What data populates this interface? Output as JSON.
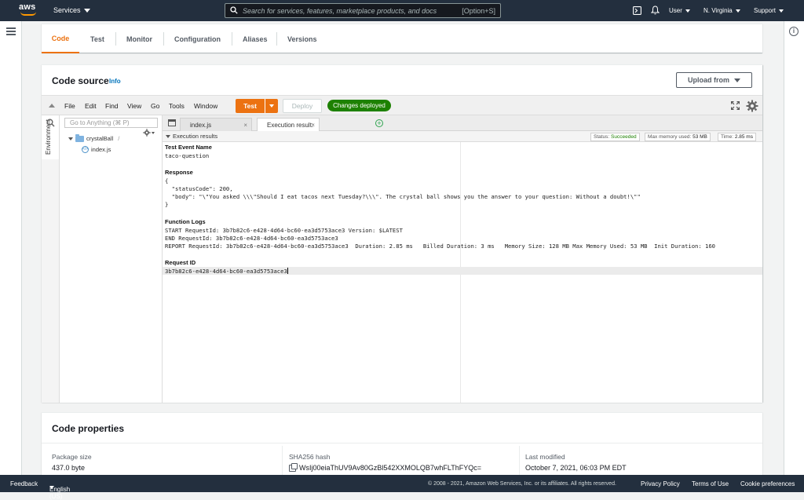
{
  "topnav": {
    "logo": "aws",
    "services_label": "Services",
    "search_placeholder": "Search for services, features, marketplace products, and docs",
    "search_shortcut": "[Option+S]",
    "user_label": "User",
    "region_label": "N. Virginia",
    "support_label": "Support",
    "icons": [
      "terminal-icon",
      "bell-icon"
    ]
  },
  "tabs": [
    {
      "label": "Code",
      "active": true
    },
    {
      "label": "Test"
    },
    {
      "label": "Monitor"
    },
    {
      "label": "Configuration"
    },
    {
      "label": "Aliases"
    },
    {
      "label": "Versions"
    }
  ],
  "code_source": {
    "title": "Code source",
    "info": "Info",
    "upload_label": "Upload from"
  },
  "ide": {
    "menus": [
      "File",
      "Edit",
      "Find",
      "View",
      "Go",
      "Tools",
      "Window"
    ],
    "test_label": "Test",
    "deploy_label": "Deploy",
    "deployed_badge": "Changes deployed",
    "environment_label": "Environment",
    "goto_placeholder": "Go to Anything (⌘ P)",
    "tree": {
      "folder": "crystalBall",
      "folder_suffix": "/",
      "file": "index.js"
    },
    "editor_tabs": [
      {
        "label": "index.js",
        "active": false
      },
      {
        "label": "Execution result:",
        "active": true
      }
    ],
    "results_title": "Execution results",
    "status_label": "Status:",
    "status_value": "Succeeded",
    "memory_label": "Max memory used:",
    "memory_value": "53 MB",
    "time_label": "Time:",
    "time_value": "2.85 ms",
    "results": {
      "test_event_label": "Test Event Name",
      "test_event_value": "taco-question",
      "response_label": "Response",
      "response_lines": [
        "{",
        "  \"statusCode\": 200,",
        "  \"body\": \"\\\"You asked \\\\\\\"Should I eat tacos next Tuesday?\\\\\\\". The crystal ball shows you the answer to your question: Without a doubt!\\\"\"",
        "}"
      ],
      "function_logs_label": "Function Logs",
      "log_lines": [
        "START RequestId: 3b7b82c6-e428-4d64-bc60-ea3d5753ace3 Version: $LATEST",
        "END RequestId: 3b7b82c6-e428-4d64-bc60-ea3d5753ace3",
        "REPORT RequestId: 3b7b82c6-e428-4d64-bc60-ea3d5753ace3  Duration: 2.85 ms   Billed Duration: 3 ms   Memory Size: 128 MB Max Memory Used: 53 MB  Init Duration: 160"
      ],
      "request_id_label": "Request ID",
      "request_id_value": "3b7b82c6-e428-4d64-bc60-ea3d5753ace3"
    }
  },
  "code_properties": {
    "title": "Code properties",
    "package_size_label": "Package size",
    "package_size_value": "437.0 byte",
    "sha_label": "SHA256 hash",
    "sha_value": "WsIj00eiaThUV9Av80GzBl542XXMOLQB7whFLThFYQc=",
    "modified_label": "Last modified",
    "modified_value": "October 7, 2021, 06:03 PM EDT"
  },
  "footer": {
    "feedback": "Feedback",
    "language": "English (US)",
    "copyright": "© 2008 - 2021, Amazon Web Services, Inc. or its affiliates. All rights reserved.",
    "privacy": "Privacy Policy",
    "terms": "Terms of Use",
    "cookies": "Cookie preferences"
  }
}
